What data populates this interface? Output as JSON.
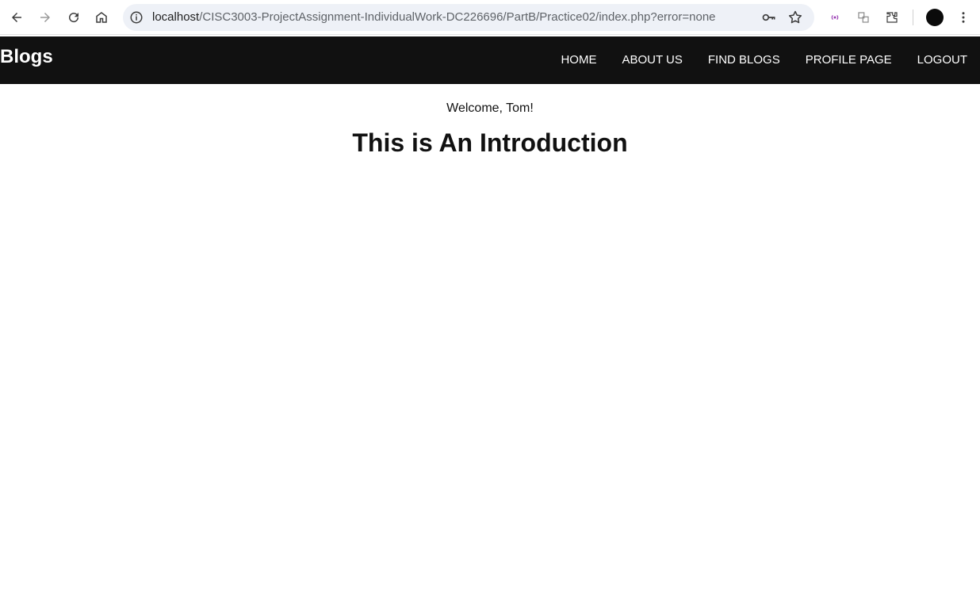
{
  "browser": {
    "url_host": "localhost",
    "url_path": "/CISC3003-ProjectAssignment-IndividualWork-DC226696/PartB/Practice02/index.php?error=none",
    "icons": [
      "back-icon",
      "forward-icon",
      "reload-icon",
      "home-icon",
      "info-icon",
      "key-icon",
      "star-icon",
      "cast-icon",
      "translate-icon",
      "extensions-icon",
      "profile-avatar",
      "menu-dots-icon"
    ]
  },
  "nav": {
    "brand": "Blogs",
    "links": [
      "HOME",
      "ABOUT US",
      "FIND BLOGS",
      "PROFILE PAGE",
      "LOGOUT"
    ]
  },
  "main": {
    "welcome": "Welcome, Tom!",
    "title": "This is An Introduction"
  },
  "colors": {
    "nav_bg": "#111111",
    "nav_text": "#ffffff",
    "page_bg": "#ffffff",
    "omnibox_bg": "#eef1f7"
  }
}
